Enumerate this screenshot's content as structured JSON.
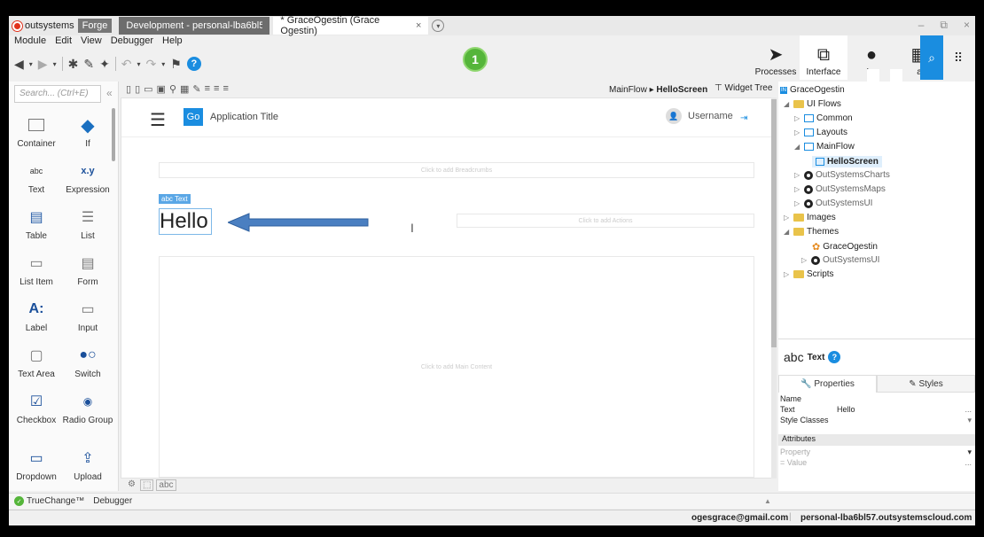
{
  "titlebar": {
    "brand": "outsystems",
    "forge": "Forge",
    "tab_dev": "Development - personal-lba6bl57....",
    "tab_grace": "* GraceOgestin (Grace Ogestin)",
    "tab_close": "×",
    "tab_add": "▾",
    "win_min": "–",
    "win_restore": "⧉",
    "win_close": "×"
  },
  "menu": [
    "Module",
    "Edit",
    "View",
    "Debugger",
    "Help"
  ],
  "toolbar": {
    "help": "?"
  },
  "step_badge": "1",
  "topnav": {
    "processes": "Processes",
    "interface": "Interface",
    "logic": "Lo",
    "data": "a"
  },
  "toolbox": {
    "search_placeholder": "Search... (Ctrl+E)",
    "collapse": "«",
    "items": {
      "container": "Container",
      "if": "If",
      "text": "Text",
      "expression": "Expression",
      "table": "Table",
      "list": "List",
      "list_item": "List Item",
      "form": "Form",
      "label": "Label",
      "input": "Input",
      "text_area": "Text Area",
      "switch": "Switch",
      "checkbox": "Checkbox",
      "radio_group": "Radio Group",
      "dropdown": "Dropdown",
      "upload": "Upload"
    },
    "glyphs": {
      "text": "abc",
      "expression": "x.y",
      "label": "A:"
    }
  },
  "breadcrumb": {
    "flow": "MainFlow ▸",
    "screen": "HelloScreen"
  },
  "widget_tree_tab": "Widget Tree",
  "canvas": {
    "app_title": "Application Title",
    "logo": "Go",
    "username": "Username",
    "breadcrumbs_placeholder": "Click to add Breadcrumbs",
    "actions_placeholder": "Click to add Actions",
    "main_placeholder": "Click to add Main Content",
    "text_tag": "abc Text",
    "hello": "Hello",
    "bottom_tag": "abc"
  },
  "tree": {
    "root": "GraceOgestin",
    "root_badge": "IN",
    "ui_flows": "UI Flows",
    "common": "Common",
    "layouts": "Layouts",
    "mainflow": "MainFlow",
    "helloscreen": "HelloScreen",
    "charts": "OutSystemsCharts",
    "maps": "OutSystemsMaps",
    "ui": "OutSystemsUI",
    "images": "Images",
    "themes": "Themes",
    "theme_grace": "GraceOgestin",
    "theme_ui": "OutSystemsUI",
    "scripts": "Scripts"
  },
  "properties": {
    "title_glyph": "abc",
    "title": "Text",
    "help": "?",
    "tab_properties": "Properties",
    "tab_styles": "Styles",
    "name_label": "Name",
    "text_label": "Text",
    "text_value": "Hello",
    "style_classes_label": "Style Classes",
    "attributes_label": "Attributes",
    "property_label": "Property",
    "value_label": "= Value",
    "ellipsis": "...",
    "dropdown": "▾"
  },
  "bottom_tabs": {
    "truechange": "TrueChange™",
    "debugger": "Debugger"
  },
  "status": {
    "email": "ogesgrace@gmail.com",
    "environment": "personal-lba6bl57.outsystemscloud.com"
  },
  "colors": {
    "accent": "#1a8de0",
    "badge_green": "#55b53a",
    "arrow_fill": "#4a7fc1",
    "brand_red": "#e0321c"
  }
}
